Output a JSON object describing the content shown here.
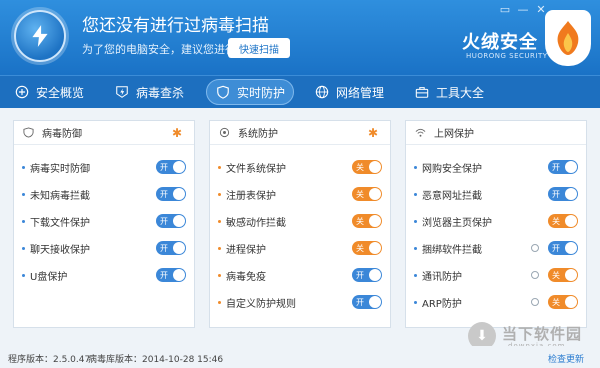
{
  "header": {
    "status_title": "您还没有进行过病毒扫描",
    "status_sub": "为了您的电脑安全，建议您进行",
    "scan_button": "快速扫描",
    "brand": "火绒安全",
    "brand_sub": "HUORONG SECURITY",
    "window_buttons": [
      "▭",
      "—",
      "✕"
    ]
  },
  "nav": [
    {
      "label": "安全概览",
      "icon": "plus-circle-icon"
    },
    {
      "label": "病毒查杀",
      "icon": "bolt-shield-icon"
    },
    {
      "label": "实时防护",
      "icon": "shield-icon",
      "active": true
    },
    {
      "label": "网络管理",
      "icon": "globe-icon"
    },
    {
      "label": "工具大全",
      "icon": "toolbox-icon"
    }
  ],
  "panels": [
    {
      "title": "病毒防御",
      "icon": "virus-shield-icon",
      "dot_color": "#3b87d8",
      "items": [
        {
          "label": "病毒实时防御",
          "state": "开",
          "on": true
        },
        {
          "label": "未知病毒拦截",
          "state": "开",
          "on": true
        },
        {
          "label": "下载文件保护",
          "state": "开",
          "on": true
        },
        {
          "label": "聊天接收保护",
          "state": "开",
          "on": true
        },
        {
          "label": "U盘保护",
          "state": "开",
          "on": true
        }
      ]
    },
    {
      "title": "系统防护",
      "icon": "system-shield-icon",
      "dot_color": "#f08b2a",
      "items": [
        {
          "label": "文件系统保护",
          "state": "关",
          "on": false
        },
        {
          "label": "注册表保护",
          "state": "关",
          "on": false
        },
        {
          "label": "敏感动作拦截",
          "state": "关",
          "on": false
        },
        {
          "label": "进程保护",
          "state": "关",
          "on": false
        },
        {
          "label": "病毒免疫",
          "state": "开",
          "on": true
        },
        {
          "label": "自定义防护规则",
          "state": "开",
          "on": true
        }
      ]
    },
    {
      "title": "上网保护",
      "icon": "wifi-icon",
      "dot_color": "#3b87d8",
      "items": [
        {
          "label": "网购安全保护",
          "state": "开",
          "on": true
        },
        {
          "label": "恶意网址拦截",
          "state": "开",
          "on": true
        },
        {
          "label": "浏览器主页保护",
          "state": "关",
          "on": false
        },
        {
          "label": "捆绑软件拦截",
          "state": "开",
          "on": true,
          "config": true
        },
        {
          "label": "通讯防护",
          "state": "关",
          "on": false,
          "config": true
        },
        {
          "label": "ARP防护",
          "state": "关",
          "on": false,
          "config": true
        }
      ]
    }
  ],
  "footer": {
    "program_version": "程序版本：2.5.0.47",
    "db_version": "病毒库版本：2014-10-28 15:46",
    "check_update": "检查更新"
  },
  "watermark": {
    "main": "当下软件园",
    "sub": "downxia.com"
  }
}
